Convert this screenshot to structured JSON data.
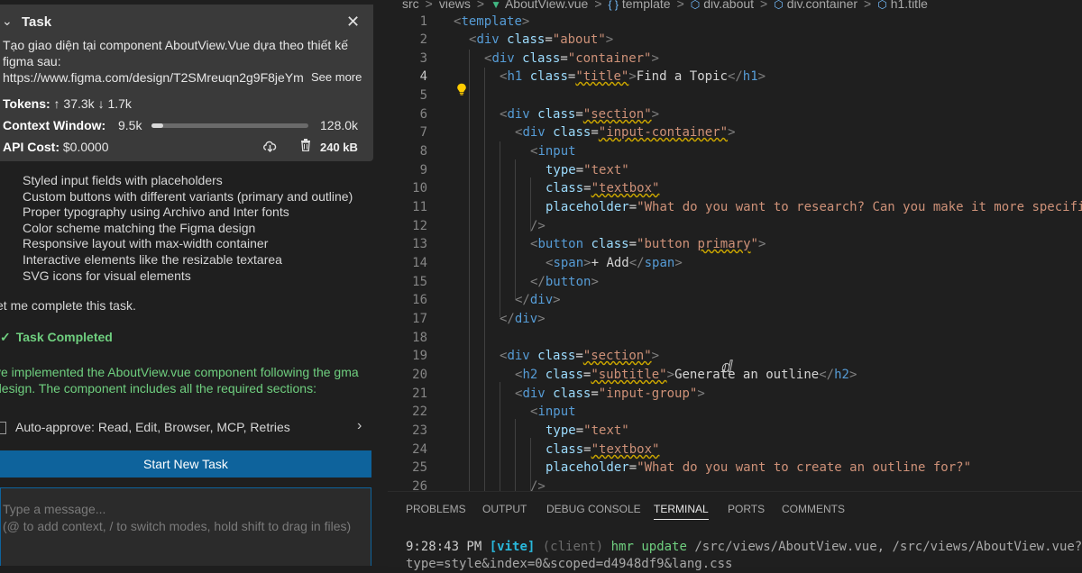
{
  "task": {
    "title": "Task",
    "description": "Tạo giao diện tại component AboutView.Vue dựa theo thiết kế figma sau:",
    "url": "https://www.figma.com/design/T2SMreuqn2g9F8jeYm",
    "see_more": "See more",
    "tokens_label": "Tokens:",
    "tokens_up": "↑ 37.3k",
    "tokens_down": "↓ 1.7k",
    "context_label": "Context Window:",
    "context_used": "9.5k",
    "context_max": "128.0k",
    "context_fraction": 0.074,
    "cost_label": "API Cost:",
    "cost_value": "$0.0000",
    "size": "240 kB"
  },
  "features": [
    "Styled input fields with placeholders",
    "Custom buttons with different variants (primary and outline)",
    "Proper typography using Archivo and Inter fonts",
    "Color scheme matching the Figma design",
    "Responsive layout with max-width container",
    "Interactive elements like the resizable textarea",
    "SVG icons for visual elements"
  ],
  "complete_message": "et me complete this task.",
  "completed": {
    "heading": "Task Completed",
    "body": "ve implemented the AboutView.vue component following the gma design. The component includes all the required sections:"
  },
  "auto_approve": {
    "label": "Auto-approve:",
    "items": "Read, Edit, Browser, MCP, Retries"
  },
  "start_new_task": "Start New Task",
  "message_placeholder": "Type a message...\n(@ to add context, / to switch modes, hold shift to drag in files)",
  "breadcrumb": [
    "src",
    "views",
    "AboutView.vue",
    "template",
    "div.about",
    "div.container",
    "h1.title"
  ],
  "code": {
    "line_numbers": [
      "1",
      "2",
      "3",
      "4",
      "5",
      "6",
      "7",
      "8",
      "9",
      "10",
      "11",
      "12",
      "13",
      "14",
      "15",
      "16",
      "17",
      "18",
      "19",
      "20",
      "21",
      "22",
      "23",
      "24",
      "25",
      "26"
    ],
    "l1_tag": "template",
    "l2_tag": "div",
    "l2_attr": "class",
    "l2_val": "\"about\"",
    "l3_tag": "div",
    "l3_attr": "class",
    "l3_val": "\"container\"",
    "l4_tag": "h1",
    "l4_attr": "class",
    "l4_val": "\"title\"",
    "l4_text": "Find a Topic",
    "l4_close": "h1",
    "l6_tag": "div",
    "l6_attr": "class",
    "l6_val": "\"section\"",
    "l7_tag": "div",
    "l7_attr": "class",
    "l7_val": "\"input-container\"",
    "l8_tag": "input",
    "l9_attr": "type",
    "l9_val": "\"text\"",
    "l10_attr": "class",
    "l10_val": "\"textbox\"",
    "l11_attr": "placeholder",
    "l11_val": "\"What do you want to research? Can you make it more specific",
    "l12_close": "/>",
    "l13_tag": "button",
    "l13_attr": "class",
    "l13_val_a": "\"button",
    "l13_val_b": "primary",
    "l13_val_c": "\"",
    "l14_tag": "span",
    "l14_text": "+ Add",
    "l14_close": "span",
    "l15_close": "button",
    "l16_close": "div",
    "l17_close": "div",
    "l19_tag": "div",
    "l19_attr": "class",
    "l19_val": "\"section\"",
    "l20_tag": "h2",
    "l20_attr": "class",
    "l20_val": "\"subtitle\"",
    "l20_text": "Generate an outline",
    "l20_close": "h2",
    "l21_tag": "div",
    "l21_attr": "class",
    "l21_val": "\"input-group\"",
    "l22_tag": "input",
    "l23_attr": "type",
    "l23_val": "\"text\"",
    "l24_attr": "class",
    "l24_val": "\"textbox\"",
    "l25_attr": "placeholder",
    "l25_val": "\"What do you want to create an outline for?\"",
    "l26_close": "/>"
  },
  "panel_tabs": [
    "PROBLEMS",
    "OUTPUT",
    "DEBUG CONSOLE",
    "TERMINAL",
    "PORTS",
    "COMMENTS"
  ],
  "terminal": {
    "time": "9:28:43 PM",
    "vite": "[vite]",
    "client": "(client)",
    "hmr": "hmr update",
    "paths": "/src/views/AboutView.vue, /src/views/AboutView.vue?v",
    "line2": "type=style&index=0&scoped=d4948df9&lang.css"
  }
}
